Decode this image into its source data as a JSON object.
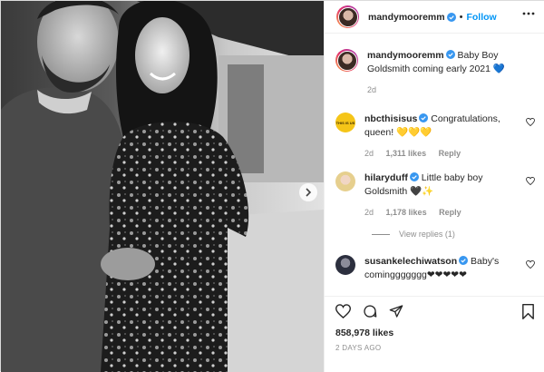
{
  "author": {
    "username": "mandymooremm",
    "follow_label": "Follow",
    "separator": "•"
  },
  "caption": {
    "username": "mandymooremm",
    "text": "Baby Boy Goldsmith coming early 2021",
    "emoji": "💙",
    "age": "2d"
  },
  "comments": [
    {
      "username": "nbcthisisus",
      "text": "Congratulations, queen! 💛💛💛",
      "age": "2d",
      "likes": "1,311 likes",
      "reply_label": "Reply",
      "avatar_text": "THIS IS US"
    },
    {
      "username": "hilaryduff",
      "text": "Little baby boy Goldsmith 🖤✨",
      "age": "2d",
      "likes": "1,178 likes",
      "reply_label": "Reply"
    },
    {
      "username": "susankelechiwatson",
      "text": "Baby's cominggggggg❤❤❤❤❤"
    }
  ],
  "view_replies": "View replies (1)",
  "likes_count": "858,978 likes",
  "posted_time": "2 DAYS AGO",
  "colors": {
    "link": "#0095f6",
    "verified": "#3897f0",
    "text": "#262626",
    "muted": "#8e8e8e"
  },
  "icons": [
    "verified-badge-icon",
    "more-options-icon",
    "heart-icon",
    "comment-icon",
    "share-icon",
    "bookmark-icon",
    "chevron-right-icon"
  ]
}
